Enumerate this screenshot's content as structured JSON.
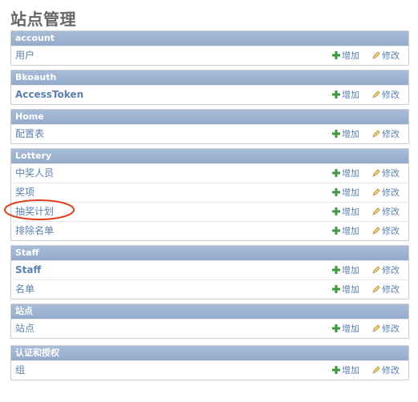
{
  "page": {
    "title": "站点管理"
  },
  "actions": {
    "add_label": "增加",
    "edit_label": "修改"
  },
  "modules": [
    {
      "name": "account",
      "rows": [
        {
          "label": "用户"
        }
      ]
    },
    {
      "name": "Bkoauth",
      "rows": [
        {
          "label": "AccessToken"
        }
      ]
    },
    {
      "name": "Home",
      "rows": [
        {
          "label": "配置表"
        }
      ]
    },
    {
      "name": "Lottery",
      "rows": [
        {
          "label": "中奖人员"
        },
        {
          "label": "奖项"
        },
        {
          "label": "抽奖计划"
        },
        {
          "label": "排除名单"
        }
      ]
    },
    {
      "name": "Staff",
      "rows": [
        {
          "label": "Staff"
        },
        {
          "label": "名单"
        }
      ]
    },
    {
      "name": "站点",
      "rows": [
        {
          "label": "站点"
        }
      ]
    },
    {
      "name": "认证和授权",
      "rows": [
        {
          "label": "组"
        }
      ]
    }
  ],
  "colors": {
    "header_bg": "#a0b6d4",
    "link": "#5b80b2",
    "add_icon": "#3a9a3a",
    "annotation": "#e2401c"
  },
  "icons": {
    "add": "plus-icon",
    "edit": "pencil-icon"
  }
}
